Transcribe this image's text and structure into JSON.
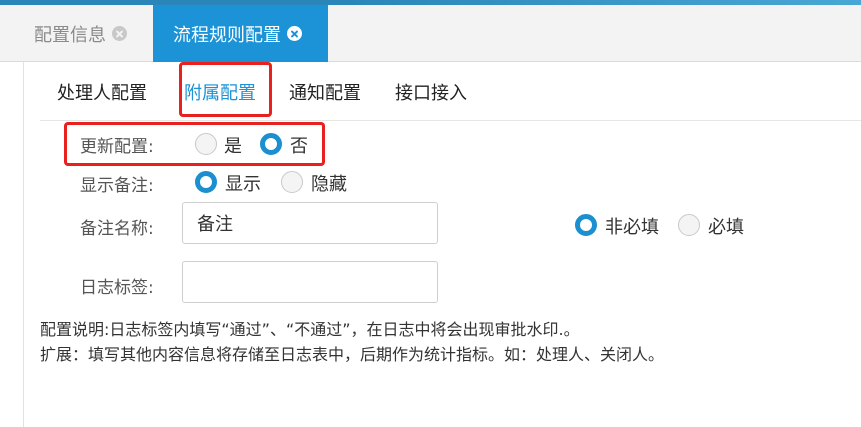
{
  "tabs": [
    {
      "label": "配置信息"
    },
    {
      "label": "流程规则配置"
    }
  ],
  "subtabs": [
    {
      "label": "处理人配置"
    },
    {
      "label": "附属配置"
    },
    {
      "label": "通知配置"
    },
    {
      "label": "接口接入"
    }
  ],
  "form": {
    "update_config": {
      "label": "更新配置:",
      "options": [
        "是",
        "否"
      ],
      "selected": "否"
    },
    "show_note": {
      "label": "显示备注:",
      "options": [
        "显示",
        "隐藏"
      ],
      "selected": "显示"
    },
    "note_name": {
      "label": "备注名称:",
      "value": "备注",
      "options": [
        "非必填",
        "必填"
      ],
      "selected": "非必填"
    },
    "log_tag": {
      "label": "日志标签:",
      "value": ""
    }
  },
  "notes": [
    "配置说明:日志标签内填写“通过”、“不通过”，在日志中将会出现审批水印.。",
    "扩展：填写其他内容信息将存储至日志表中，后期作为统计指标。如：处理人、关闭人。"
  ],
  "colors": {
    "accent": "#1b93d6",
    "highlight": "#e8211e"
  }
}
